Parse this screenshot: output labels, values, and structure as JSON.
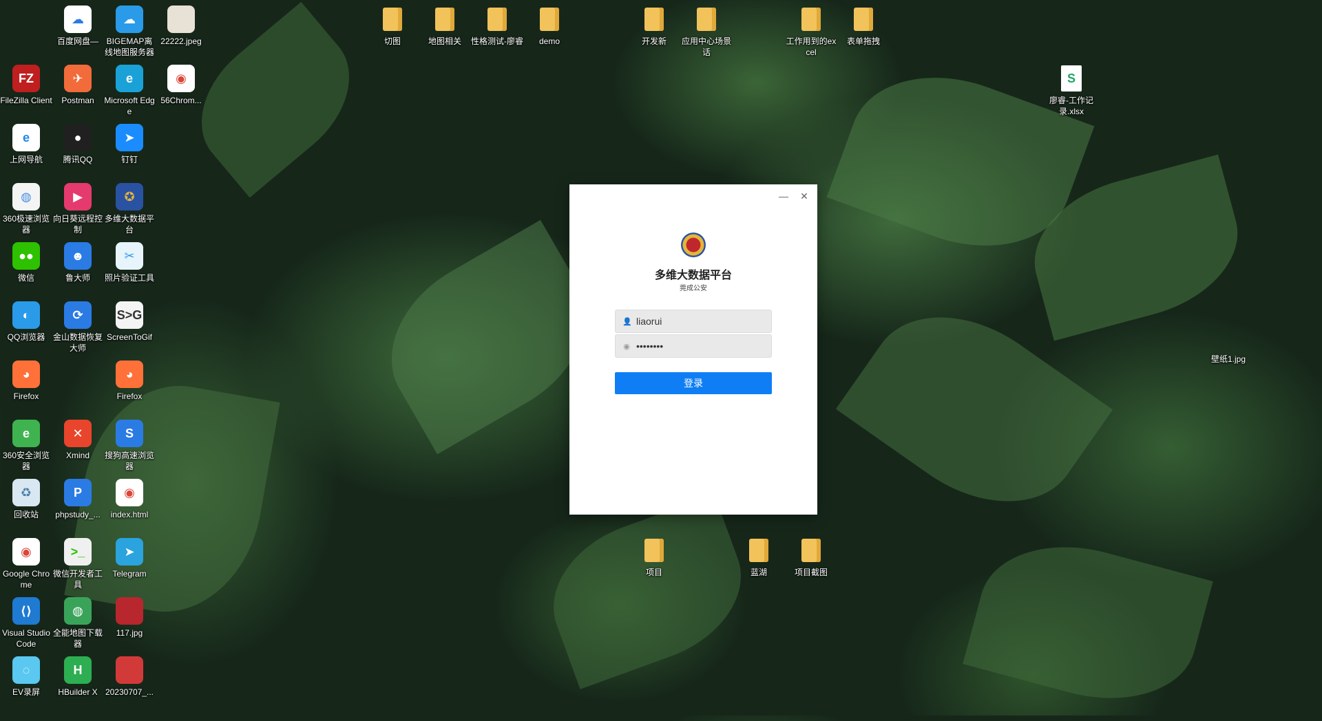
{
  "desktop": {
    "icons": [
      {
        "id": "baidu",
        "label": "百度网盘—",
        "glyph": "☁",
        "bg": "#ffffff",
        "fg": "#2a7be4",
        "type": "app"
      },
      {
        "id": "bigemap",
        "label": "BIGEMAP离线地图服务器",
        "glyph": "☁",
        "bg": "#2a9be8",
        "fg": "#fff",
        "type": "app"
      },
      {
        "id": "img22222",
        "label": "22222.jpeg",
        "glyph": "",
        "bg": "#e8e2d6",
        "fg": "#333",
        "type": "photo"
      },
      {
        "id": "filezilla",
        "label": "FileZilla Client",
        "glyph": "FZ",
        "bg": "#bf1f1f",
        "fg": "#fff",
        "type": "app"
      },
      {
        "id": "postman",
        "label": "Postman",
        "glyph": "✈",
        "bg": "#f26b3a",
        "fg": "#fff",
        "type": "app"
      },
      {
        "id": "edge",
        "label": "Microsoft Edge",
        "glyph": "e",
        "bg": "#1aa2d8",
        "fg": "#fff",
        "type": "app"
      },
      {
        "id": "chrome56",
        "label": "56Chrom...",
        "glyph": "◉",
        "bg": "#ffffff",
        "fg": "#db4437",
        "type": "app"
      },
      {
        "id": "ie",
        "label": "上网导航",
        "glyph": "e",
        "bg": "#ffffff",
        "fg": "#1e88e5",
        "type": "app"
      },
      {
        "id": "qq",
        "label": "腾讯QQ",
        "glyph": "●",
        "bg": "#202020",
        "fg": "#fff",
        "type": "app"
      },
      {
        "id": "dingtalk",
        "label": "钉钉",
        "glyph": "➤",
        "bg": "#1a8cff",
        "fg": "#fff",
        "type": "app"
      },
      {
        "id": "b360",
        "label": "360极速浏览器",
        "glyph": "◍",
        "bg": "#f4f4f4",
        "fg": "#4a90e2",
        "type": "app"
      },
      {
        "id": "sunlogin",
        "label": "向日葵远程控制",
        "glyph": "▶",
        "bg": "#e53a6d",
        "fg": "#fff",
        "type": "app"
      },
      {
        "id": "dwdata",
        "label": "多维大数据平台",
        "glyph": "✪",
        "bg": "#2952a3",
        "fg": "#e4b53a",
        "type": "app"
      },
      {
        "id": "wechat",
        "label": "微信",
        "glyph": "●●",
        "bg": "#2dc100",
        "fg": "#fff",
        "type": "app"
      },
      {
        "id": "ludashi",
        "label": "鲁大师",
        "glyph": "☻",
        "bg": "#2a7be4",
        "fg": "#fff",
        "type": "app"
      },
      {
        "id": "photoverify",
        "label": "照片验证工具",
        "glyph": "✂",
        "bg": "#e8f4fb",
        "fg": "#2a9be8",
        "type": "app"
      },
      {
        "id": "qqbrowser",
        "label": "QQ浏览器",
        "glyph": "◐",
        "bg": "#2a9be8",
        "fg": "#fff",
        "type": "app"
      },
      {
        "id": "kingsoft",
        "label": "金山数据恢复大师",
        "glyph": "⟳",
        "bg": "#2a7be4",
        "fg": "#fff",
        "type": "app"
      },
      {
        "id": "screentogif",
        "label": "ScreenToGif",
        "glyph": "S>G",
        "bg": "#f4f4f4",
        "fg": "#333",
        "type": "app"
      },
      {
        "id": "firefox1",
        "label": "Firefox",
        "glyph": "◕",
        "bg": "#ff7139",
        "fg": "#fff",
        "type": "app"
      },
      {
        "id": "firefox2",
        "label": "Firefox",
        "glyph": "◕",
        "bg": "#ff7139",
        "fg": "#fff",
        "type": "app"
      },
      {
        "id": "safe360",
        "label": "360安全浏览器",
        "glyph": "e",
        "bg": "#3fb34f",
        "fg": "#fff",
        "type": "app"
      },
      {
        "id": "xmind",
        "label": "Xmind",
        "glyph": "✕",
        "bg": "#e8452c",
        "fg": "#fff",
        "type": "app"
      },
      {
        "id": "sogou",
        "label": "搜狗高速浏览器",
        "glyph": "S",
        "bg": "#2a7be4",
        "fg": "#fff",
        "type": "app"
      },
      {
        "id": "recycle",
        "label": "回收站",
        "glyph": "♻",
        "bg": "#d9e7f2",
        "fg": "#4a7fa8",
        "type": "app"
      },
      {
        "id": "phpstudy",
        "label": "phpstudy_...",
        "glyph": "P",
        "bg": "#2a7be4",
        "fg": "#fff",
        "type": "app"
      },
      {
        "id": "indexhtml",
        "label": "index.html",
        "glyph": "◉",
        "bg": "#ffffff",
        "fg": "#db4437",
        "type": "app"
      },
      {
        "id": "chrome",
        "label": "Google Chrome",
        "glyph": "◉",
        "bg": "#ffffff",
        "fg": "#db4437",
        "type": "app"
      },
      {
        "id": "wxdev",
        "label": "微信开发者工具",
        "glyph": ">_",
        "bg": "#f0f0f0",
        "fg": "#2dc100",
        "type": "app"
      },
      {
        "id": "telegram",
        "label": "Telegram",
        "glyph": "➤",
        "bg": "#2aa3de",
        "fg": "#fff",
        "type": "app"
      },
      {
        "id": "vscode",
        "label": "Visual Studio Code",
        "glyph": "⟨⟩",
        "bg": "#1f7ad1",
        "fg": "#fff",
        "type": "app"
      },
      {
        "id": "mapdl",
        "label": "全能地图下载器",
        "glyph": "◍",
        "bg": "#3aa35a",
        "fg": "#fff",
        "type": "app"
      },
      {
        "id": "img117",
        "label": "117.jpg",
        "glyph": "",
        "bg": "#b8262e",
        "fg": "#fff",
        "type": "photo"
      },
      {
        "id": "evrec",
        "label": "EV录屏",
        "glyph": "◌",
        "bg": "#5ac8f0",
        "fg": "#fff",
        "type": "app"
      },
      {
        "id": "hbuilder",
        "label": "HBuilder X",
        "glyph": "H",
        "bg": "#2dae52",
        "fg": "#fff",
        "type": "app"
      },
      {
        "id": "img20230707",
        "label": "20230707_...",
        "glyph": "",
        "bg": "#d23a3a",
        "fg": "#fff",
        "type": "photo"
      },
      {
        "id": "qietu",
        "label": "切图",
        "type": "folder"
      },
      {
        "id": "maprel",
        "label": "地图相关",
        "type": "folder"
      },
      {
        "id": "xingge",
        "label": "性格测试-廖睿",
        "type": "folder"
      },
      {
        "id": "demo",
        "label": "demo",
        "type": "folder"
      },
      {
        "id": "kaifa",
        "label": "开发新",
        "type": "folder"
      },
      {
        "id": "appcenter",
        "label": "应用中心场景话",
        "type": "folder"
      },
      {
        "id": "workexcel",
        "label": "工作用到的excel",
        "type": "folder"
      },
      {
        "id": "biaodan",
        "label": "表单拖拽",
        "type": "folder"
      },
      {
        "id": "worklog",
        "label": "廖睿-工作记录.xlsx",
        "type": "file",
        "glyph": "S",
        "fg": "#21a366"
      },
      {
        "id": "wallpaper",
        "label": "壁纸1.jpg",
        "type": "plain"
      },
      {
        "id": "xiangmu",
        "label": "项目",
        "type": "folder"
      },
      {
        "id": "lanhu",
        "label": "蓝湖",
        "type": "folder"
      },
      {
        "id": "xmjt",
        "label": "项目截图",
        "type": "folder"
      }
    ]
  },
  "dialog": {
    "minimize_glyph": "—",
    "close_glyph": "✕",
    "title": "多维大数据平台",
    "subtitle": "莞成公安",
    "username": {
      "value": "liaorui",
      "icon": "user-icon",
      "glyph": "👤"
    },
    "password": {
      "value": "liaorui1",
      "icon": "eye-icon",
      "glyph": "◉"
    },
    "login_label": "登录",
    "accent_color": "#0f7ef5"
  }
}
